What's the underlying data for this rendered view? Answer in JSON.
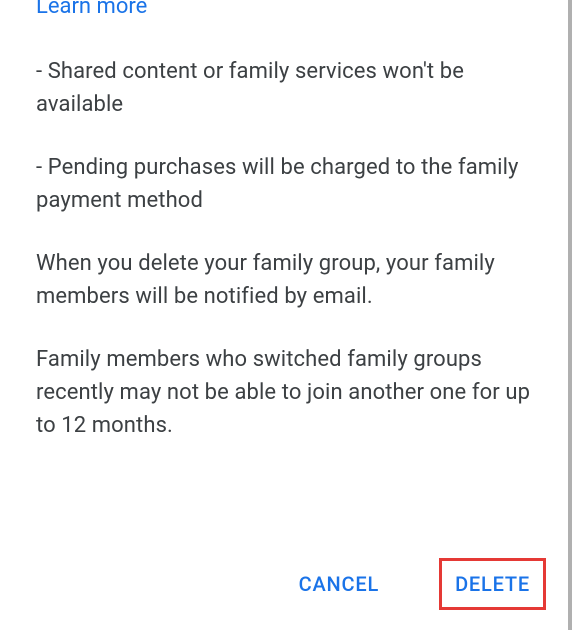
{
  "learn_more": "Learn more",
  "paragraphs": {
    "p1": "- Shared content or family services won't be available",
    "p2": "- Pending purchases will be charged to the family payment method",
    "p3": "When you delete your family group, your family members will be notified by email.",
    "p4": "Family members who switched family groups recently may not be able to join another one for up to 12 months."
  },
  "actions": {
    "cancel": "CANCEL",
    "delete": "DELETE"
  }
}
